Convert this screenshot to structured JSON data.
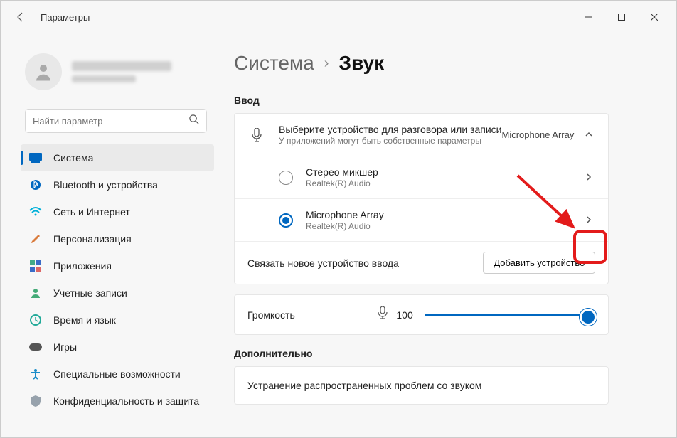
{
  "window": {
    "title": "Параметры"
  },
  "search": {
    "placeholder": "Найти параметр"
  },
  "nav": {
    "items": [
      {
        "label": "Система"
      },
      {
        "label": "Bluetooth и устройства"
      },
      {
        "label": "Сеть и Интернет"
      },
      {
        "label": "Персонализация"
      },
      {
        "label": "Приложения"
      },
      {
        "label": "Учетные записи"
      },
      {
        "label": "Время и язык"
      },
      {
        "label": "Игры"
      },
      {
        "label": "Специальные возможности"
      },
      {
        "label": "Конфиденциальность и защита"
      }
    ]
  },
  "breadcrumb": {
    "parent": "Система",
    "current": "Звук"
  },
  "sections": {
    "input": {
      "title": "Ввод",
      "choose": {
        "title": "Выберите устройство для разговора или записи",
        "sub": "У приложений могут быть собственные параметры",
        "selected": "Microphone Array"
      },
      "devices": [
        {
          "name": "Стерео микшер",
          "vendor": "Realtek(R) Audio",
          "selected": false
        },
        {
          "name": "Microphone Array",
          "vendor": "Realtek(R) Audio",
          "selected": true
        }
      ],
      "pair": {
        "label": "Связать новое устройство ввода",
        "button": "Добавить устройство"
      },
      "volume": {
        "label": "Громкость",
        "value": "100"
      }
    },
    "advanced": {
      "title": "Дополнительно",
      "troubleshoot": "Устранение распространенных проблем со звуком"
    }
  }
}
